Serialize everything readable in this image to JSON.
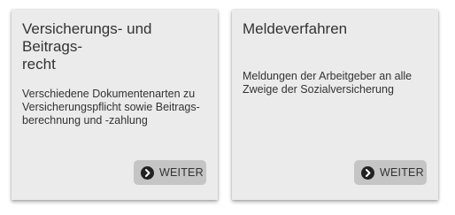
{
  "cards": [
    {
      "title": "Versicherungs- und Beitrags-\nrecht",
      "description": "Verschiedene Dokumentenarten zu\nVersicherungspflicht sowie Beitrags-\nberechnung und -zahlung",
      "button_label": "WEITER",
      "button_icon": "arrow-right-circle-icon"
    },
    {
      "title": "Meldeverfahren",
      "description": "Meldungen der Arbeitgeber an alle\nZweige der Sozialversicherung",
      "button_label": "WEITER",
      "button_icon": "arrow-right-circle-icon"
    }
  ]
}
